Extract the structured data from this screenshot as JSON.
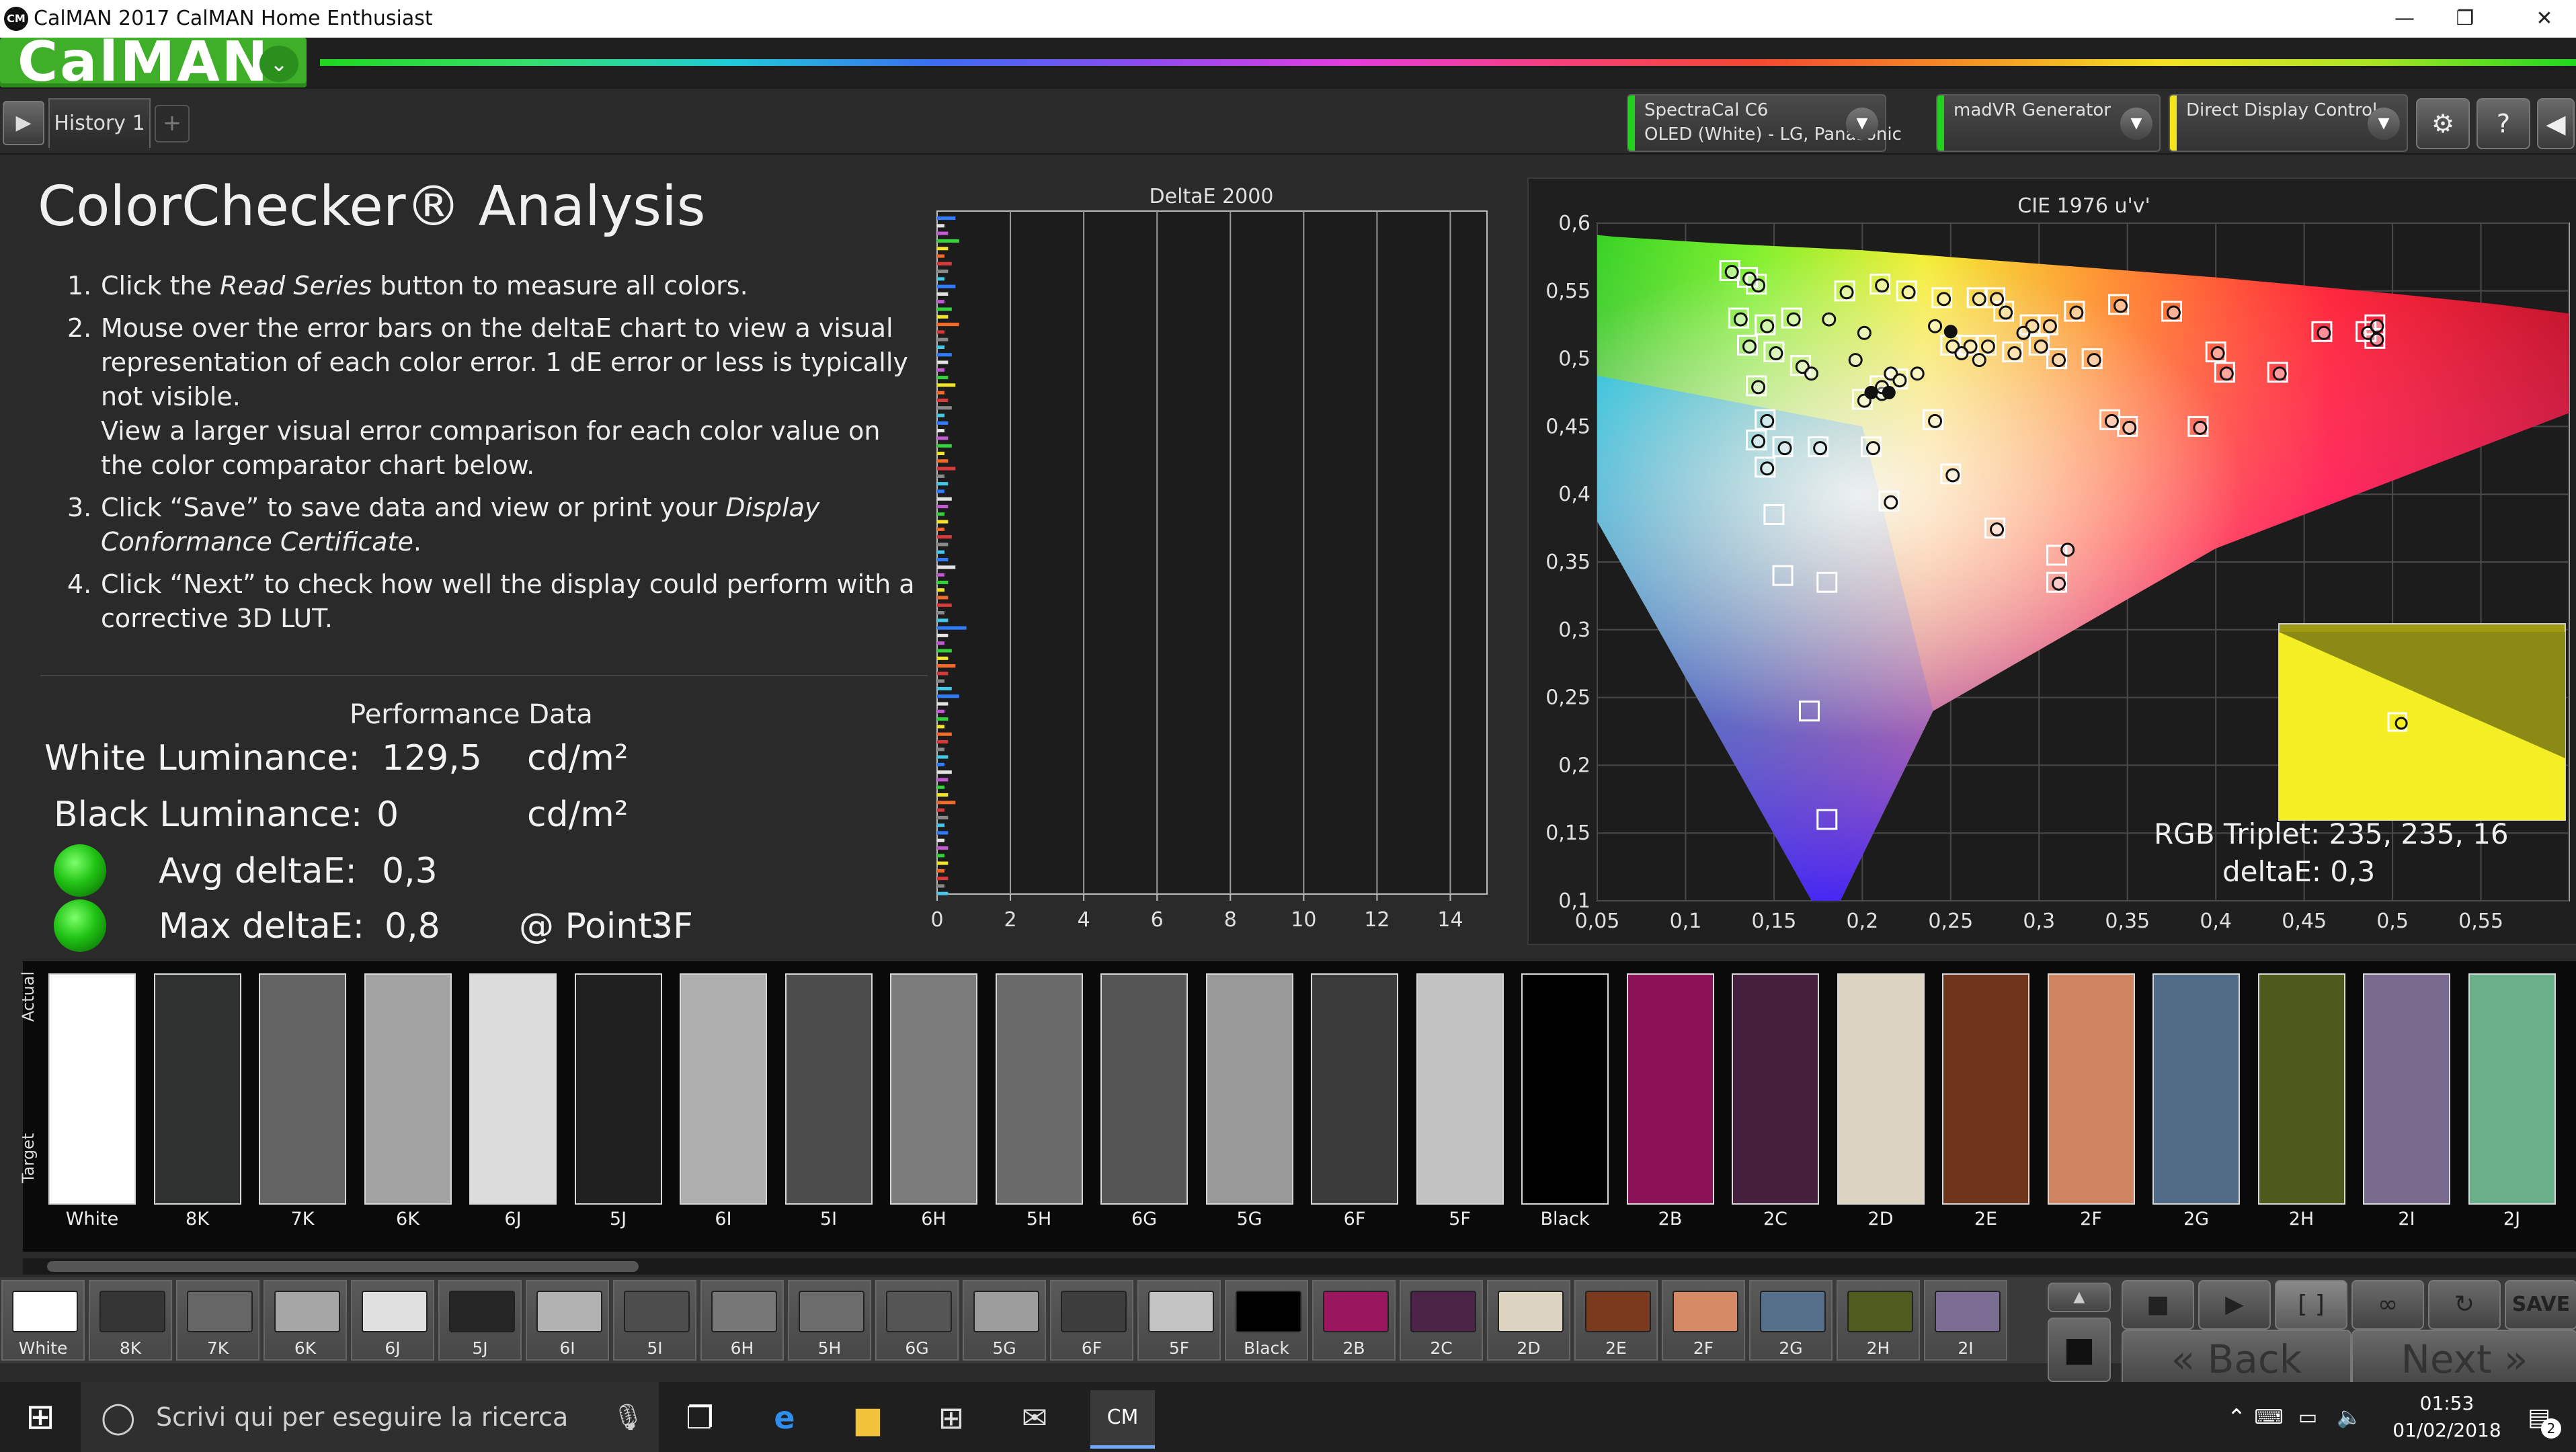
{
  "window": {
    "title": "CalMAN 2017 CalMAN Home Enthusiast",
    "app_icon": "CM",
    "minimize_glyph": "—",
    "maximize_glyph": "❐",
    "close_glyph": "✕"
  },
  "brand": {
    "logo_text": "CalMAN",
    "logo_chevron": "⌄"
  },
  "toolbar": {
    "play_glyph": "▶",
    "tab_label": "History 1",
    "add_tab_glyph": "+",
    "meter": {
      "line1": "SpectraCal C6",
      "line2": "OLED (White) - LG, Panasonic",
      "stripe_color": "#22d11c"
    },
    "generator": {
      "line1": "madVR Generator",
      "stripe_color": "#22d11c"
    },
    "display": {
      "line1": "Direct Display Control",
      "stripe_color": "#f2e51c"
    },
    "dropdown_glyph": "▼",
    "settings_glyph": "⚙",
    "help_glyph": "?",
    "collapse_glyph": "◀"
  },
  "main": {
    "title": "ColorChecker® Analysis",
    "steps": [
      {
        "num": "1.",
        "pre": "Click the ",
        "em": "Read Series",
        "post": " button to measure all colors."
      },
      {
        "num": "2.",
        "pre": "Mouse over the error bars on the deltaE chart to view a visual representation of each color error. 1 dE error or less is typically not visible.",
        "em": "",
        "post": ""
      },
      {
        "num": "",
        "pre": "View a larger visual error comparison for each color value on the color comparator chart below.",
        "em": "",
        "post": ""
      },
      {
        "num": "3.",
        "pre": "Click “Save” to save data and view or print your ",
        "em": "Display Conformance Certificate",
        "post": "."
      },
      {
        "num": "4.",
        "pre": "Click “Next” to check how well the display could perform with a corrective 3D LUT.",
        "em": "",
        "post": ""
      }
    ]
  },
  "performance": {
    "title": "Performance Data",
    "white_label": "White Luminance:",
    "white_value": "129,5",
    "white_unit": "cd/m²",
    "black_label": "Black Luminance:",
    "black_value": "0",
    "black_unit": "cd/m²",
    "avg_label": "Avg deltaE:",
    "avg_value": "0,3",
    "max_label": "Max deltaE:",
    "max_value": "0,8",
    "point_label": "@ Point:",
    "point_value": "3F"
  },
  "chart_data": [
    {
      "type": "bar",
      "title": "DeltaE 2000",
      "orientation": "horizontal",
      "xlim": [
        0,
        15
      ],
      "xticks": [
        "0",
        "2",
        "4",
        "6",
        "8",
        "10",
        "12",
        "14"
      ],
      "values": [
        0.5,
        0.2,
        0.3,
        0.6,
        0.3,
        0.2,
        0.4,
        0.3,
        0.2,
        0.5,
        0.3,
        0.2,
        0.4,
        0.3,
        0.6,
        0.2,
        0.3,
        0.2,
        0.4,
        0.3,
        0.2,
        0.3,
        0.5,
        0.2,
        0.3,
        0.4,
        0.2,
        0.3,
        0.2,
        0.3,
        0.4,
        0.2,
        0.3,
        0.5,
        0.2,
        0.3,
        0.2,
        0.4,
        0.3,
        0.2,
        0.3,
        0.2,
        0.4,
        0.3,
        0.2,
        0.3,
        0.5,
        0.2,
        0.3,
        0.2,
        0.3,
        0.4,
        0.2,
        0.3,
        0.8,
        0.3,
        0.2,
        0.4,
        0.3,
        0.5,
        0.3,
        0.2,
        0.4,
        0.6,
        0.3,
        0.2,
        0.3,
        0.2,
        0.4,
        0.3,
        0.2,
        0.3,
        0.2,
        0.4,
        0.3,
        0.2,
        0.3,
        0.5,
        0.2,
        0.3,
        0.2,
        0.3,
        0.2,
        0.3,
        0.2,
        0.3,
        0.2,
        0.3,
        0.2,
        0.3
      ],
      "bar_colors": [
        "#2f7cff",
        "#e2e2e2",
        "#c25ad1",
        "#35d13a",
        "#f2e42b",
        "#f26b2b",
        "#d63a3a",
        "#8a8a8a",
        "#47c7e6"
      ]
    },
    {
      "type": "scatter",
      "title": "CIE 1976 u'v'",
      "xlim": [
        0.05,
        0.6
      ],
      "ylim": [
        0.1,
        0.6
      ],
      "xticks": [
        "0,05",
        "0,1",
        "0,15",
        "0,2",
        "0,25",
        "0,3",
        "0,35",
        "0,4",
        "0,45",
        "0,5",
        "0,55"
      ],
      "yticks": [
        "0,1",
        "0,15",
        "0,2",
        "0,25",
        "0,3",
        "0,35",
        "0,4",
        "0,45",
        "0,5",
        "0,55",
        "0,6"
      ],
      "targets": [
        [
          0.125,
          0.565
        ],
        [
          0.135,
          0.56
        ],
        [
          0.14,
          0.555
        ],
        [
          0.13,
          0.53
        ],
        [
          0.145,
          0.525
        ],
        [
          0.16,
          0.53
        ],
        [
          0.135,
          0.51
        ],
        [
          0.15,
          0.505
        ],
        [
          0.165,
          0.495
        ],
        [
          0.14,
          0.48
        ],
        [
          0.145,
          0.455
        ],
        [
          0.14,
          0.44
        ],
        [
          0.155,
          0.435
        ],
        [
          0.175,
          0.435
        ],
        [
          0.205,
          0.435
        ],
        [
          0.145,
          0.42
        ],
        [
          0.15,
          0.385
        ],
        [
          0.155,
          0.34
        ],
        [
          0.18,
          0.335
        ],
        [
          0.17,
          0.24
        ],
        [
          0.18,
          0.16
        ],
        [
          0.2,
          0.47
        ],
        [
          0.22,
          0.485
        ],
        [
          0.19,
          0.55
        ],
        [
          0.21,
          0.555
        ],
        [
          0.225,
          0.55
        ],
        [
          0.245,
          0.545
        ],
        [
          0.265,
          0.545
        ],
        [
          0.275,
          0.545
        ],
        [
          0.28,
          0.535
        ],
        [
          0.295,
          0.525
        ],
        [
          0.305,
          0.525
        ],
        [
          0.32,
          0.535
        ],
        [
          0.345,
          0.54
        ],
        [
          0.375,
          0.535
        ],
        [
          0.25,
          0.51
        ],
        [
          0.26,
          0.51
        ],
        [
          0.27,
          0.51
        ],
        [
          0.285,
          0.505
        ],
        [
          0.3,
          0.51
        ],
        [
          0.31,
          0.5
        ],
        [
          0.33,
          0.5
        ],
        [
          0.4,
          0.505
        ],
        [
          0.405,
          0.49
        ],
        [
          0.435,
          0.49
        ],
        [
          0.46,
          0.52
        ],
        [
          0.485,
          0.52
        ],
        [
          0.49,
          0.525
        ],
        [
          0.49,
          0.515
        ],
        [
          0.24,
          0.455
        ],
        [
          0.25,
          0.415
        ],
        [
          0.215,
          0.395
        ],
        [
          0.275,
          0.375
        ],
        [
          0.31,
          0.355
        ],
        [
          0.31,
          0.335
        ],
        [
          0.34,
          0.455
        ],
        [
          0.35,
          0.45
        ],
        [
          0.39,
          0.45
        ],
        [
          0.21,
          0.48
        ]
      ],
      "points": [
        [
          0.125,
          0.565
        ],
        [
          0.135,
          0.56
        ],
        [
          0.14,
          0.555
        ],
        [
          0.13,
          0.53
        ],
        [
          0.145,
          0.525
        ],
        [
          0.16,
          0.53
        ],
        [
          0.135,
          0.51
        ],
        [
          0.15,
          0.505
        ],
        [
          0.165,
          0.495
        ],
        [
          0.14,
          0.48
        ],
        [
          0.145,
          0.455
        ],
        [
          0.14,
          0.44
        ],
        [
          0.155,
          0.435
        ],
        [
          0.175,
          0.435
        ],
        [
          0.205,
          0.435
        ],
        [
          0.145,
          0.42
        ],
        [
          0.195,
          0.5
        ],
        [
          0.215,
          0.49
        ],
        [
          0.23,
          0.49
        ],
        [
          0.2,
          0.47
        ],
        [
          0.21,
          0.475
        ],
        [
          0.22,
          0.485
        ],
        [
          0.19,
          0.55
        ],
        [
          0.21,
          0.555
        ],
        [
          0.225,
          0.55
        ],
        [
          0.245,
          0.545
        ],
        [
          0.265,
          0.545
        ],
        [
          0.275,
          0.545
        ],
        [
          0.28,
          0.535
        ],
        [
          0.295,
          0.525
        ],
        [
          0.305,
          0.525
        ],
        [
          0.32,
          0.535
        ],
        [
          0.345,
          0.54
        ],
        [
          0.375,
          0.535
        ],
        [
          0.25,
          0.51
        ],
        [
          0.26,
          0.51
        ],
        [
          0.27,
          0.51
        ],
        [
          0.285,
          0.505
        ],
        [
          0.3,
          0.51
        ],
        [
          0.31,
          0.5
        ],
        [
          0.33,
          0.5
        ],
        [
          0.4,
          0.505
        ],
        [
          0.405,
          0.49
        ],
        [
          0.435,
          0.49
        ],
        [
          0.46,
          0.52
        ],
        [
          0.485,
          0.52
        ],
        [
          0.49,
          0.525
        ],
        [
          0.49,
          0.515
        ],
        [
          0.24,
          0.455
        ],
        [
          0.25,
          0.415
        ],
        [
          0.215,
          0.395
        ],
        [
          0.275,
          0.375
        ],
        [
          0.315,
          0.36
        ],
        [
          0.31,
          0.335
        ],
        [
          0.34,
          0.455
        ],
        [
          0.35,
          0.45
        ],
        [
          0.39,
          0.45
        ],
        [
          0.21,
          0.48
        ],
        [
          0.255,
          0.505
        ],
        [
          0.18,
          0.53
        ],
        [
          0.24,
          0.525
        ],
        [
          0.265,
          0.5
        ],
        [
          0.29,
          0.52
        ],
        [
          0.2,
          0.52
        ],
        [
          0.17,
          0.49
        ]
      ],
      "dark_points": [
        [
          0.205,
          0.475
        ],
        [
          0.215,
          0.475
        ],
        [
          0.25,
          0.52
        ]
      ],
      "inset": {
        "target": [
          0.462,
          0.29
        ]
      }
    }
  ],
  "readout": {
    "rgb_label": "RGB Triplet:",
    "rgb_value": "235, 235, 16",
    "delta_label": "deltaE:",
    "delta_value": "0,3"
  },
  "swatch_strip": {
    "actual_label": "Actual",
    "target_label": "Target",
    "items": [
      {
        "label": "White",
        "color": "#ffffff"
      },
      {
        "label": "8K",
        "color": "#2e3130"
      },
      {
        "label": "7K",
        "color": "#636363"
      },
      {
        "label": "6K",
        "color": "#a3a3a3"
      },
      {
        "label": "6J",
        "color": "#dcdcdc"
      },
      {
        "label": "5J",
        "color": "#202020"
      },
      {
        "label": "6I",
        "color": "#afafaf"
      },
      {
        "label": "5I",
        "color": "#4c4c4c"
      },
      {
        "label": "6H",
        "color": "#7b7b7b"
      },
      {
        "label": "5H",
        "color": "#6a6a6a"
      },
      {
        "label": "6G",
        "color": "#555555"
      },
      {
        "label": "5G",
        "color": "#999999"
      },
      {
        "label": "6F",
        "color": "#3b3b3b"
      },
      {
        "label": "5F",
        "color": "#c2c2c2"
      },
      {
        "label": "Black",
        "color": "#000000"
      },
      {
        "label": "2B",
        "color": "#8c1257"
      },
      {
        "label": "2C",
        "color": "#45203d"
      },
      {
        "label": "2D",
        "color": "#ddd3c1"
      },
      {
        "label": "2E",
        "color": "#6f351a"
      },
      {
        "label": "2F",
        "color": "#d08562"
      },
      {
        "label": "2G",
        "color": "#516a85"
      },
      {
        "label": "2H",
        "color": "#4c5a1b"
      },
      {
        "label": "2I",
        "color": "#776a8c"
      },
      {
        "label": "2J",
        "color": "#69b08a"
      }
    ]
  },
  "tiles": [
    {
      "label": "White",
      "color": "#ffffff"
    },
    {
      "label": "8K",
      "color": "#353535"
    },
    {
      "label": "7K",
      "color": "#666666"
    },
    {
      "label": "6K",
      "color": "#a6a6a6"
    },
    {
      "label": "6J",
      "color": "#e0e0e0"
    },
    {
      "label": "5J",
      "color": "#262626"
    },
    {
      "label": "6I",
      "color": "#b2b2b2"
    },
    {
      "label": "5I",
      "color": "#4d4d4d"
    },
    {
      "label": "6H",
      "color": "#777777"
    },
    {
      "label": "5H",
      "color": "#6c6c6c"
    },
    {
      "label": "6G",
      "color": "#555555"
    },
    {
      "label": "5G",
      "color": "#9c9c9c"
    },
    {
      "label": "6F",
      "color": "#3d3d3d"
    },
    {
      "label": "5F",
      "color": "#c3c3c3"
    },
    {
      "label": "Black",
      "color": "#000000"
    },
    {
      "label": "2B",
      "color": "#9a1760"
    },
    {
      "label": "2C",
      "color": "#4c2447"
    },
    {
      "label": "2D",
      "color": "#ddd3c1"
    },
    {
      "label": "2E",
      "color": "#7a3a1d"
    },
    {
      "label": "2F",
      "color": "#d58a65"
    },
    {
      "label": "2G",
      "color": "#56708c"
    },
    {
      "label": "2H",
      "color": "#4f5c1d"
    },
    {
      "label": "2I",
      "color": "#7b6d92"
    }
  ],
  "controls": {
    "scroll_up_glyph": "▲",
    "stop_glyph": "■",
    "play_glyph": "▶",
    "loop_glyph": "↻",
    "save_label": "SAVE",
    "back_label": "Back",
    "next_label": "Next",
    "back_glyph": "«",
    "next_glyph": "»"
  },
  "taskbar": {
    "start_glyph": "⊞",
    "search_placeholder": "Scrivi qui per eseguire la ricerca",
    "mic_glyph": "🎙",
    "time": "01:53",
    "date": "01/02/2018",
    "notifications_count": "2"
  }
}
